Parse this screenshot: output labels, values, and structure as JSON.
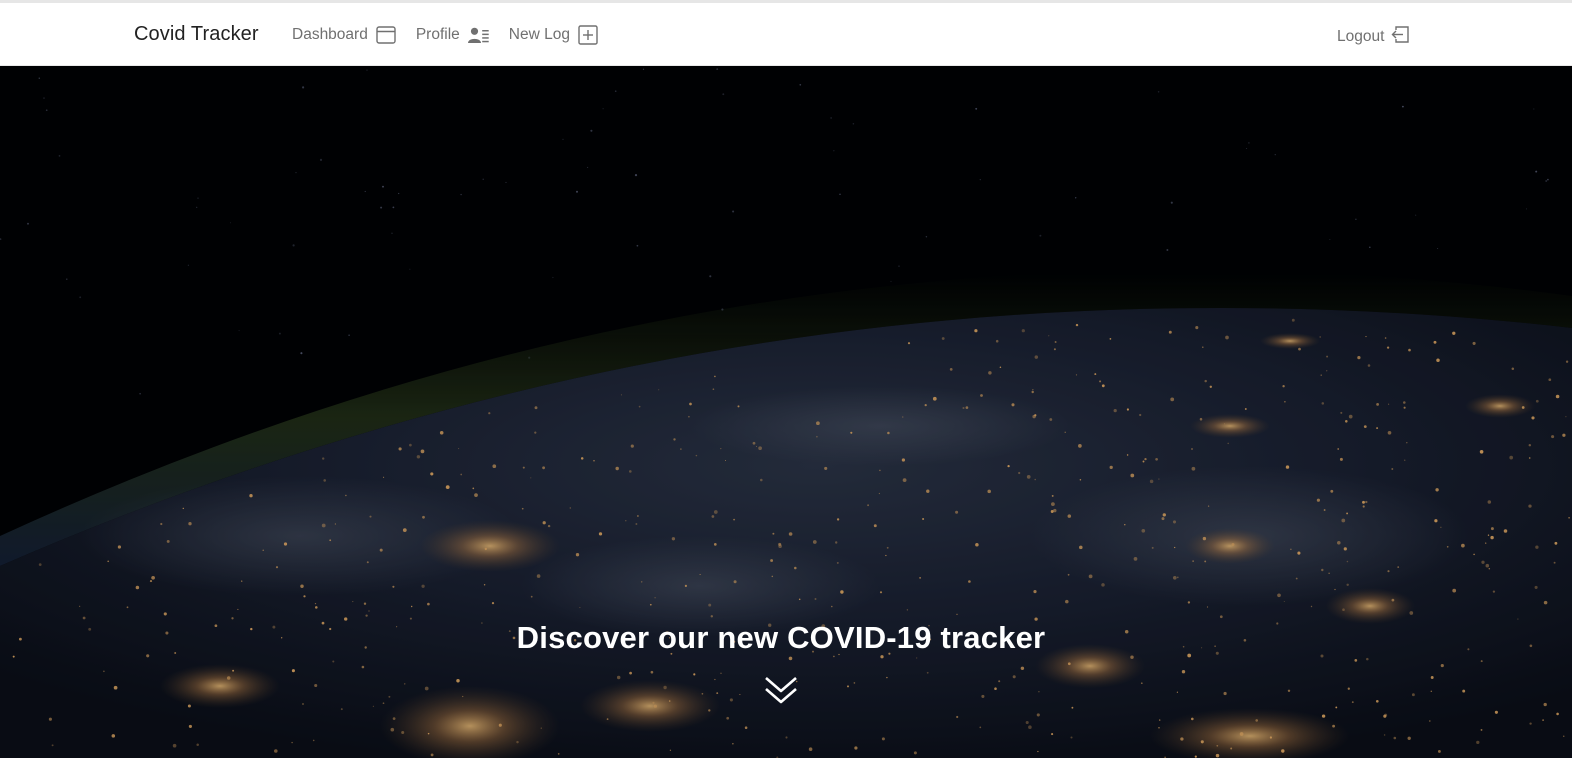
{
  "navbar": {
    "brand": "Covid Tracker",
    "links": [
      {
        "label": "Dashboard",
        "icon": "window-icon"
      },
      {
        "label": "Profile",
        "icon": "person-lines-icon"
      },
      {
        "label": "New Log",
        "icon": "plus-square-icon"
      }
    ],
    "logout_label": "Logout",
    "logout_icon": "box-arrow-in-left-icon"
  },
  "hero": {
    "background": "earth-at-night-from-space",
    "title": "Discover our new COVID-19 tracker",
    "scroll_icon": "chevron-double-down-icon"
  },
  "colors": {
    "nav_text": "#707070",
    "brand_text": "#222222",
    "hero_bg": "#010204",
    "hero_text": "#ffffff"
  }
}
